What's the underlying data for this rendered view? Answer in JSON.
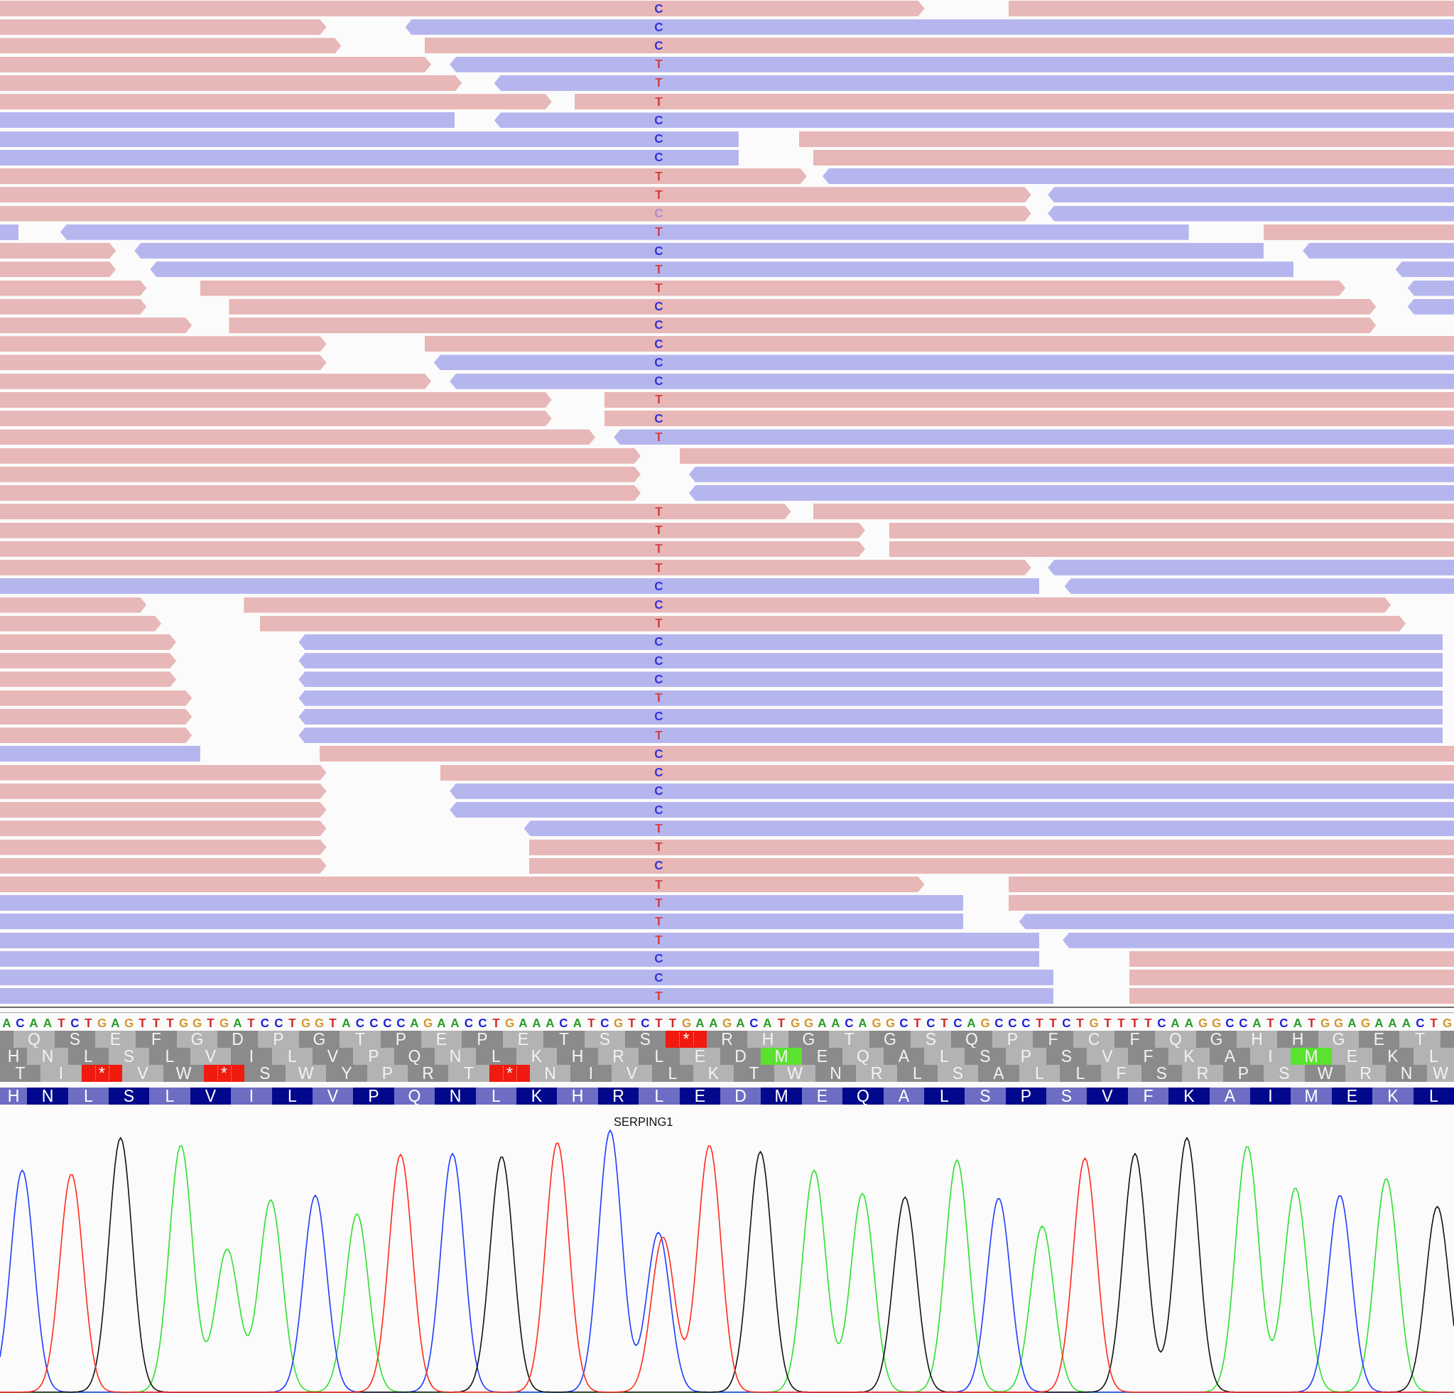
{
  "alignment": {
    "rows": [
      {
        "segments": [
          {
            "reverse": false
          },
          {
            "reverse": false
          }
        ],
        "center_base": {
          "text": "C",
          "color": "#3232dc"
        }
      },
      {
        "segments": [
          {
            "reverse": false
          },
          {
            "reverse": true
          }
        ],
        "center_base": {
          "text": "C",
          "color": "#3232dc"
        }
      },
      {
        "segments": [
          {
            "reverse": false
          },
          {
            "reverse": false
          }
        ],
        "center_base": {
          "text": "C",
          "color": "#3232dc"
        }
      },
      {
        "segments": [
          {
            "reverse": false
          },
          {
            "reverse": true
          }
        ],
        "center_base": {
          "text": "T",
          "color": "#d43c3c"
        }
      },
      {
        "segments": [
          {
            "reverse": false
          },
          {
            "reverse": true
          }
        ],
        "center_base": {
          "text": "T",
          "color": "#d43c3c"
        }
      },
      {
        "segments": [
          {
            "reverse": false
          },
          {
            "reverse": false
          }
        ],
        "center_base": {
          "text": "T",
          "color": "#d43c3c"
        }
      },
      {
        "segments": [
          {
            "reverse": true
          },
          {
            "reverse": true
          }
        ],
        "center_base": {
          "text": "C",
          "color": "#3232dc"
        }
      },
      {
        "segments": [
          {
            "reverse": true
          },
          {
            "reverse": false
          }
        ],
        "center_base": {
          "text": "C",
          "color": "#3232dc"
        }
      },
      {
        "segments": [
          {
            "reverse": true
          },
          {
            "reverse": false
          }
        ],
        "center_base": {
          "text": "C",
          "color": "#3232dc"
        }
      },
      {
        "segments": [
          {
            "reverse": false
          },
          {
            "reverse": true
          }
        ],
        "center_base": {
          "text": "T",
          "color": "#d43c3c"
        }
      },
      {
        "segments": [
          {
            "reverse": false
          },
          {
            "reverse": true
          }
        ],
        "center_base": {
          "text": "T",
          "color": "#d43c3c"
        }
      },
      {
        "segments": [
          {
            "reverse": false
          },
          {
            "reverse": true
          }
        ],
        "center_base": {
          "text": "C",
          "color": "#a88cc8"
        }
      },
      {
        "segments": [
          {
            "reverse": true
          },
          {
            "reverse": true
          },
          {
            "reverse": false
          }
        ],
        "center_base": {
          "text": "T",
          "color": "#d43c3c"
        }
      },
      {
        "segments": [
          {
            "reverse": false
          },
          {
            "reverse": true
          },
          {
            "reverse": true
          }
        ],
        "center_base": {
          "text": "C",
          "color": "#3232dc"
        }
      },
      {
        "segments": [
          {
            "reverse": false
          },
          {
            "reverse": true
          },
          {
            "reverse": true
          }
        ],
        "center_base": {
          "text": "T",
          "color": "#d43c3c"
        }
      },
      {
        "segments": [
          {
            "reverse": false
          },
          {
            "reverse": false
          },
          {
            "reverse": true
          }
        ],
        "center_base": {
          "text": "T",
          "color": "#d43c3c"
        }
      },
      {
        "segments": [
          {
            "reverse": false
          },
          {
            "reverse": false
          },
          {
            "reverse": true
          }
        ],
        "center_base": {
          "text": "C",
          "color": "#3232dc"
        }
      },
      {
        "segments": [
          {
            "reverse": false
          },
          {
            "reverse": false
          }
        ],
        "center_base": {
          "text": "C",
          "color": "#3232dc"
        }
      },
      {
        "segments": [
          {
            "reverse": false
          },
          {
            "reverse": false
          }
        ],
        "center_base": {
          "text": "C",
          "color": "#3232dc"
        }
      },
      {
        "segments": [
          {
            "reverse": false
          },
          {
            "reverse": true
          }
        ],
        "center_base": {
          "text": "C",
          "color": "#3232dc"
        }
      },
      {
        "segments": [
          {
            "reverse": false
          },
          {
            "reverse": true
          }
        ],
        "center_base": {
          "text": "C",
          "color": "#3232dc"
        }
      },
      {
        "segments": [
          {
            "reverse": false
          },
          {
            "reverse": false
          }
        ],
        "center_base": {
          "text": "T",
          "color": "#d43c3c"
        }
      },
      {
        "segments": [
          {
            "reverse": false
          },
          {
            "reverse": false
          }
        ],
        "center_base": {
          "text": "C",
          "color": "#3232dc"
        }
      },
      {
        "segments": [
          {
            "reverse": false
          },
          {
            "reverse": true
          }
        ],
        "center_base": {
          "text": "T",
          "color": "#d43c3c"
        }
      },
      {
        "segments": [
          {
            "reverse": false
          },
          {
            "reverse": false
          }
        ]
      },
      {
        "segments": [
          {
            "reverse": false
          },
          {
            "reverse": true
          }
        ]
      },
      {
        "segments": [
          {
            "reverse": false
          },
          {
            "reverse": true
          }
        ]
      },
      {
        "segments": [
          {
            "reverse": false
          },
          {
            "reverse": false
          }
        ],
        "center_base": {
          "text": "T",
          "color": "#d43c3c"
        }
      },
      {
        "segments": [
          {
            "reverse": false
          },
          {
            "reverse": false
          }
        ],
        "center_base": {
          "text": "T",
          "color": "#d43c3c"
        }
      },
      {
        "segments": [
          {
            "reverse": false
          },
          {
            "reverse": false
          }
        ],
        "center_base": {
          "text": "T",
          "color": "#d43c3c"
        }
      },
      {
        "segments": [
          {
            "reverse": false
          },
          {
            "reverse": true
          }
        ],
        "center_base": {
          "text": "T",
          "color": "#d43c3c"
        }
      },
      {
        "segments": [
          {
            "reverse": true
          },
          {
            "reverse": true
          }
        ],
        "center_base": {
          "text": "C",
          "color": "#3232dc"
        }
      },
      {
        "segments": [
          {
            "reverse": false
          },
          {
            "reverse": false
          }
        ],
        "center_base": {
          "text": "C",
          "color": "#3232dc"
        }
      },
      {
        "segments": [
          {
            "reverse": false
          },
          {
            "reverse": false
          }
        ],
        "center_base": {
          "text": "T",
          "color": "#d43c3c"
        }
      },
      {
        "segments": [
          {
            "reverse": false
          },
          {
            "reverse": true
          }
        ],
        "center_base": {
          "text": "C",
          "color": "#3232dc"
        }
      },
      {
        "segments": [
          {
            "reverse": false
          },
          {
            "reverse": true
          }
        ],
        "center_base": {
          "text": "C",
          "color": "#3232dc"
        }
      },
      {
        "segments": [
          {
            "reverse": false
          },
          {
            "reverse": true
          }
        ],
        "center_base": {
          "text": "C",
          "color": "#3232dc"
        }
      },
      {
        "segments": [
          {
            "reverse": false
          },
          {
            "reverse": true
          }
        ],
        "center_base": {
          "text": "T",
          "color": "#d43c3c"
        }
      },
      {
        "segments": [
          {
            "reverse": false
          },
          {
            "reverse": true
          }
        ],
        "center_base": {
          "text": "C",
          "color": "#3232dc"
        }
      },
      {
        "segments": [
          {
            "reverse": false
          },
          {
            "reverse": true
          }
        ],
        "center_base": {
          "text": "T",
          "color": "#d43c3c"
        }
      },
      {
        "segments": [
          {
            "reverse": true
          },
          {
            "reverse": false
          }
        ],
        "center_base": {
          "text": "C",
          "color": "#3232dc"
        }
      },
      {
        "segments": [
          {
            "reverse": false
          },
          {
            "reverse": false
          }
        ],
        "center_base": {
          "text": "C",
          "color": "#3232dc"
        }
      },
      {
        "segments": [
          {
            "reverse": false
          },
          {
            "reverse": true
          }
        ],
        "center_base": {
          "text": "C",
          "color": "#3232dc"
        }
      },
      {
        "segments": [
          {
            "reverse": false
          },
          {
            "reverse": true
          }
        ],
        "center_base": {
          "text": "C",
          "color": "#3232dc"
        }
      },
      {
        "segments": [
          {
            "reverse": false
          },
          {
            "reverse": true
          }
        ],
        "center_base": {
          "text": "T",
          "color": "#d43c3c"
        }
      },
      {
        "segments": [
          {
            "reverse": false
          },
          {
            "reverse": false
          }
        ],
        "center_base": {
          "text": "T",
          "color": "#d43c3c"
        }
      },
      {
        "segments": [
          {
            "reverse": false
          },
          {
            "reverse": false
          }
        ],
        "center_base": {
          "text": "C",
          "color": "#3232dc"
        }
      },
      {
        "segments": [
          {
            "reverse": false
          },
          {
            "reverse": false
          }
        ],
        "center_base": {
          "text": "T",
          "color": "#d43c3c"
        }
      },
      {
        "segments": [
          {
            "reverse": true
          },
          {
            "reverse": false
          }
        ],
        "center_base": {
          "text": "T",
          "color": "#d43c3c"
        }
      },
      {
        "segments": [
          {
            "reverse": true
          },
          {
            "reverse": true
          }
        ],
        "center_base": {
          "text": "T",
          "color": "#d43c3c"
        }
      },
      {
        "segments": [
          {
            "reverse": true
          },
          {
            "reverse": true
          }
        ],
        "center_base": {
          "text": "T",
          "color": "#d43c3c"
        }
      },
      {
        "segments": [
          {
            "reverse": true
          },
          {
            "reverse": false
          }
        ],
        "center_base": {
          "text": "C",
          "color": "#3232dc"
        }
      },
      {
        "segments": [
          {
            "reverse": true
          },
          {
            "reverse": false
          }
        ],
        "center_base": {
          "text": "C",
          "color": "#3232dc"
        }
      },
      {
        "segments": [
          {
            "reverse": true
          },
          {
            "reverse": false
          }
        ],
        "center_base": {
          "text": "T",
          "color": "#d43c3c"
        }
      }
    ]
  },
  "reference": {
    "bases": [
      {
        "base": "A",
        "color": "#2a9d2a"
      },
      {
        "base": "C",
        "color": "#1a1adb"
      },
      {
        "base": "A",
        "color": "#2a9d2a"
      },
      {
        "base": "A",
        "color": "#2a9d2a"
      },
      {
        "base": "T",
        "color": "#d42525"
      },
      {
        "base": "C",
        "color": "#1a1adb"
      },
      {
        "base": "T",
        "color": "#d42525"
      },
      {
        "base": "G",
        "color": "#d4962c"
      },
      {
        "base": "A",
        "color": "#2a9d2a"
      },
      {
        "base": "G",
        "color": "#d4962c"
      },
      {
        "base": "T",
        "color": "#d42525"
      },
      {
        "base": "T",
        "color": "#d42525"
      },
      {
        "base": "T",
        "color": "#d42525"
      },
      {
        "base": "G",
        "color": "#d4962c"
      },
      {
        "base": "G",
        "color": "#d4962c"
      },
      {
        "base": "T",
        "color": "#d42525"
      },
      {
        "base": "G",
        "color": "#d4962c"
      },
      {
        "base": "A",
        "color": "#2a9d2a"
      },
      {
        "base": "T",
        "color": "#d42525"
      },
      {
        "base": "C",
        "color": "#1a1adb"
      },
      {
        "base": "C",
        "color": "#1a1adb"
      },
      {
        "base": "T",
        "color": "#d42525"
      },
      {
        "base": "G",
        "color": "#d4962c"
      },
      {
        "base": "G",
        "color": "#d4962c"
      },
      {
        "base": "T",
        "color": "#d42525"
      },
      {
        "base": "A",
        "color": "#2a9d2a"
      },
      {
        "base": "C",
        "color": "#1a1adb"
      },
      {
        "base": "C",
        "color": "#1a1adb"
      },
      {
        "base": "C",
        "color": "#1a1adb"
      },
      {
        "base": "C",
        "color": "#1a1adb"
      },
      {
        "base": "A",
        "color": "#2a9d2a"
      },
      {
        "base": "G",
        "color": "#d4962c"
      },
      {
        "base": "A",
        "color": "#2a9d2a"
      },
      {
        "base": "A",
        "color": "#2a9d2a"
      },
      {
        "base": "C",
        "color": "#1a1adb"
      },
      {
        "base": "C",
        "color": "#1a1adb"
      },
      {
        "base": "T",
        "color": "#d42525"
      },
      {
        "base": "G",
        "color": "#d4962c"
      },
      {
        "base": "A",
        "color": "#2a9d2a"
      },
      {
        "base": "A",
        "color": "#2a9d2a"
      },
      {
        "base": "A",
        "color": "#2a9d2a"
      },
      {
        "base": "C",
        "color": "#1a1adb"
      },
      {
        "base": "A",
        "color": "#2a9d2a"
      },
      {
        "base": "T",
        "color": "#d42525"
      },
      {
        "base": "C",
        "color": "#1a1adb"
      },
      {
        "base": "G",
        "color": "#d4962c"
      },
      {
        "base": "T",
        "color": "#d42525"
      },
      {
        "base": "C",
        "color": "#1a1adb"
      },
      {
        "base": "T",
        "color": "#d42525"
      },
      {
        "base": "T",
        "color": "#d42525"
      },
      {
        "base": "G",
        "color": "#d4962c"
      },
      {
        "base": "A",
        "color": "#2a9d2a"
      },
      {
        "base": "A",
        "color": "#2a9d2a"
      },
      {
        "base": "G",
        "color": "#d4962c"
      },
      {
        "base": "A",
        "color": "#2a9d2a"
      },
      {
        "base": "C",
        "color": "#1a1adb"
      },
      {
        "base": "A",
        "color": "#2a9d2a"
      },
      {
        "base": "T",
        "color": "#d42525"
      },
      {
        "base": "G",
        "color": "#d4962c"
      },
      {
        "base": "G",
        "color": "#d4962c"
      },
      {
        "base": "A",
        "color": "#2a9d2a"
      },
      {
        "base": "A",
        "color": "#2a9d2a"
      },
      {
        "base": "C",
        "color": "#1a1adb"
      },
      {
        "base": "A",
        "color": "#2a9d2a"
      },
      {
        "base": "G",
        "color": "#d4962c"
      },
      {
        "base": "G",
        "color": "#d4962c"
      },
      {
        "base": "C",
        "color": "#1a1adb"
      },
      {
        "base": "T",
        "color": "#d42525"
      },
      {
        "base": "C",
        "color": "#1a1adb"
      },
      {
        "base": "T",
        "color": "#d42525"
      },
      {
        "base": "C",
        "color": "#1a1adb"
      },
      {
        "base": "A",
        "color": "#2a9d2a"
      },
      {
        "base": "G",
        "color": "#d4962c"
      },
      {
        "base": "C",
        "color": "#1a1adb"
      },
      {
        "base": "C",
        "color": "#1a1adb"
      },
      {
        "base": "C",
        "color": "#1a1adb"
      },
      {
        "base": "T",
        "color": "#d42525"
      },
      {
        "base": "T",
        "color": "#d42525"
      },
      {
        "base": "C",
        "color": "#1a1adb"
      },
      {
        "base": "T",
        "color": "#d42525"
      },
      {
        "base": "G",
        "color": "#d4962c"
      },
      {
        "base": "T",
        "color": "#d42525"
      },
      {
        "base": "T",
        "color": "#d42525"
      },
      {
        "base": "T",
        "color": "#d42525"
      },
      {
        "base": "T",
        "color": "#d42525"
      },
      {
        "base": "C",
        "color": "#1a1adb"
      },
      {
        "base": "A",
        "color": "#2a9d2a"
      },
      {
        "base": "A",
        "color": "#2a9d2a"
      },
      {
        "base": "G",
        "color": "#d4962c"
      },
      {
        "base": "G",
        "color": "#d4962c"
      },
      {
        "base": "C",
        "color": "#1a1adb"
      },
      {
        "base": "C",
        "color": "#1a1adb"
      },
      {
        "base": "A",
        "color": "#2a9d2a"
      },
      {
        "base": "T",
        "color": "#d42525"
      },
      {
        "base": "C",
        "color": "#1a1adb"
      },
      {
        "base": "A",
        "color": "#2a9d2a"
      },
      {
        "base": "T",
        "color": "#d42525"
      },
      {
        "base": "G",
        "color": "#d4962c"
      },
      {
        "base": "G",
        "color": "#d4962c"
      },
      {
        "base": "A",
        "color": "#2a9d2a"
      },
      {
        "base": "G",
        "color": "#d4962c"
      },
      {
        "base": "A",
        "color": "#2a9d2a"
      },
      {
        "base": "A",
        "color": "#2a9d2a"
      },
      {
        "base": "A",
        "color": "#2a9d2a"
      },
      {
        "base": "C",
        "color": "#1a1adb"
      },
      {
        "base": "T",
        "color": "#d42525"
      },
      {
        "base": "G",
        "color": "#d4962c"
      }
    ]
  },
  "translation": {
    "frames": [
      {
        "codons": [
          {
            "aa": "Q",
            "kind": "amino"
          },
          {
            "aa": "S",
            "kind": "amino"
          },
          {
            "aa": "E",
            "kind": "amino"
          },
          {
            "aa": "F",
            "kind": "amino"
          },
          {
            "aa": "G",
            "kind": "amino"
          },
          {
            "aa": "D",
            "kind": "amino"
          },
          {
            "aa": "P",
            "kind": "amino"
          },
          {
            "aa": "G",
            "kind": "amino"
          },
          {
            "aa": "T",
            "kind": "amino"
          },
          {
            "aa": "P",
            "kind": "amino"
          },
          {
            "aa": "E",
            "kind": "amino"
          },
          {
            "aa": "P",
            "kind": "amino"
          },
          {
            "aa": "E",
            "kind": "amino"
          },
          {
            "aa": "T",
            "kind": "amino"
          },
          {
            "aa": "S",
            "kind": "amino"
          },
          {
            "aa": "S",
            "kind": "amino"
          },
          {
            "aa": "*",
            "kind": "stop"
          },
          {
            "aa": "R",
            "kind": "amino"
          },
          {
            "aa": "H",
            "kind": "amino"
          },
          {
            "aa": "G",
            "kind": "amino"
          },
          {
            "aa": "T",
            "kind": "amino"
          },
          {
            "aa": "G",
            "kind": "amino"
          },
          {
            "aa": "S",
            "kind": "amino"
          },
          {
            "aa": "Q",
            "kind": "amino"
          },
          {
            "aa": "P",
            "kind": "amino"
          },
          {
            "aa": "F",
            "kind": "amino"
          },
          {
            "aa": "C",
            "kind": "amino"
          },
          {
            "aa": "F",
            "kind": "amino"
          },
          {
            "aa": "Q",
            "kind": "amino"
          },
          {
            "aa": "G",
            "kind": "amino"
          },
          {
            "aa": "H",
            "kind": "amino"
          },
          {
            "aa": "H",
            "kind": "amino"
          },
          {
            "aa": "G",
            "kind": "amino"
          },
          {
            "aa": "E",
            "kind": "amino"
          },
          {
            "aa": "T",
            "kind": "amino"
          }
        ]
      },
      {
        "codons": [
          {
            "aa": "H",
            "kind": "amino"
          },
          {
            "aa": "N",
            "kind": "amino"
          },
          {
            "aa": "L",
            "kind": "amino"
          },
          {
            "aa": "S",
            "kind": "amino"
          },
          {
            "aa": "L",
            "kind": "amino"
          },
          {
            "aa": "V",
            "kind": "amino"
          },
          {
            "aa": "I",
            "kind": "amino"
          },
          {
            "aa": "L",
            "kind": "amino"
          },
          {
            "aa": "V",
            "kind": "amino"
          },
          {
            "aa": "P",
            "kind": "amino"
          },
          {
            "aa": "Q",
            "kind": "amino"
          },
          {
            "aa": "N",
            "kind": "amino"
          },
          {
            "aa": "L",
            "kind": "amino"
          },
          {
            "aa": "K",
            "kind": "amino"
          },
          {
            "aa": "H",
            "kind": "amino"
          },
          {
            "aa": "R",
            "kind": "amino"
          },
          {
            "aa": "L",
            "kind": "amino"
          },
          {
            "aa": "E",
            "kind": "amino"
          },
          {
            "aa": "D",
            "kind": "amino"
          },
          {
            "aa": "M",
            "kind": "start"
          },
          {
            "aa": "E",
            "kind": "amino"
          },
          {
            "aa": "Q",
            "kind": "amino"
          },
          {
            "aa": "A",
            "kind": "amino"
          },
          {
            "aa": "L",
            "kind": "amino"
          },
          {
            "aa": "S",
            "kind": "amino"
          },
          {
            "aa": "P",
            "kind": "amino"
          },
          {
            "aa": "S",
            "kind": "amino"
          },
          {
            "aa": "V",
            "kind": "amino"
          },
          {
            "aa": "F",
            "kind": "amino"
          },
          {
            "aa": "K",
            "kind": "amino"
          },
          {
            "aa": "A",
            "kind": "amino"
          },
          {
            "aa": "I",
            "kind": "amino"
          },
          {
            "aa": "M",
            "kind": "start"
          },
          {
            "aa": "E",
            "kind": "amino"
          },
          {
            "aa": "K",
            "kind": "amino"
          },
          {
            "aa": "L",
            "kind": "amino"
          }
        ]
      },
      {
        "codons": [
          {
            "aa": "T",
            "kind": "amino"
          },
          {
            "aa": "I",
            "kind": "amino"
          },
          {
            "aa": "*",
            "kind": "stop"
          },
          {
            "aa": "V",
            "kind": "amino"
          },
          {
            "aa": "W",
            "kind": "amino"
          },
          {
            "aa": "*",
            "kind": "stop"
          },
          {
            "aa": "S",
            "kind": "amino"
          },
          {
            "aa": "W",
            "kind": "amino"
          },
          {
            "aa": "Y",
            "kind": "amino"
          },
          {
            "aa": "P",
            "kind": "amino"
          },
          {
            "aa": "R",
            "kind": "amino"
          },
          {
            "aa": "T",
            "kind": "amino"
          },
          {
            "aa": "*",
            "kind": "stop"
          },
          {
            "aa": "N",
            "kind": "amino"
          },
          {
            "aa": "I",
            "kind": "amino"
          },
          {
            "aa": "V",
            "kind": "amino"
          },
          {
            "aa": "L",
            "kind": "amino"
          },
          {
            "aa": "K",
            "kind": "amino"
          },
          {
            "aa": "T",
            "kind": "amino"
          },
          {
            "aa": "W",
            "kind": "amino"
          },
          {
            "aa": "N",
            "kind": "amino"
          },
          {
            "aa": "R",
            "kind": "amino"
          },
          {
            "aa": "L",
            "kind": "amino"
          },
          {
            "aa": "S",
            "kind": "amino"
          },
          {
            "aa": "A",
            "kind": "amino"
          },
          {
            "aa": "L",
            "kind": "amino"
          },
          {
            "aa": "L",
            "kind": "amino"
          },
          {
            "aa": "F",
            "kind": "amino"
          },
          {
            "aa": "S",
            "kind": "amino"
          },
          {
            "aa": "R",
            "kind": "amino"
          },
          {
            "aa": "P",
            "kind": "amino"
          },
          {
            "aa": "S",
            "kind": "amino"
          },
          {
            "aa": "W",
            "kind": "amino"
          },
          {
            "aa": "R",
            "kind": "amino"
          },
          {
            "aa": "N",
            "kind": "amino"
          },
          {
            "aa": "W",
            "kind": "amino"
          }
        ]
      }
    ]
  },
  "gene": {
    "amino_acids": [
      "H",
      "N",
      "L",
      "S",
      "L",
      "V",
      "I",
      "L",
      "V",
      "P",
      "Q",
      "N",
      "L",
      "K",
      "H",
      "R",
      "L",
      "E",
      "D",
      "M",
      "E",
      "Q",
      "A",
      "L",
      "S",
      "P",
      "S",
      "V",
      "F",
      "K",
      "A",
      "I",
      "M",
      "E",
      "K",
      "L"
    ],
    "name": "SERPING1"
  }
}
